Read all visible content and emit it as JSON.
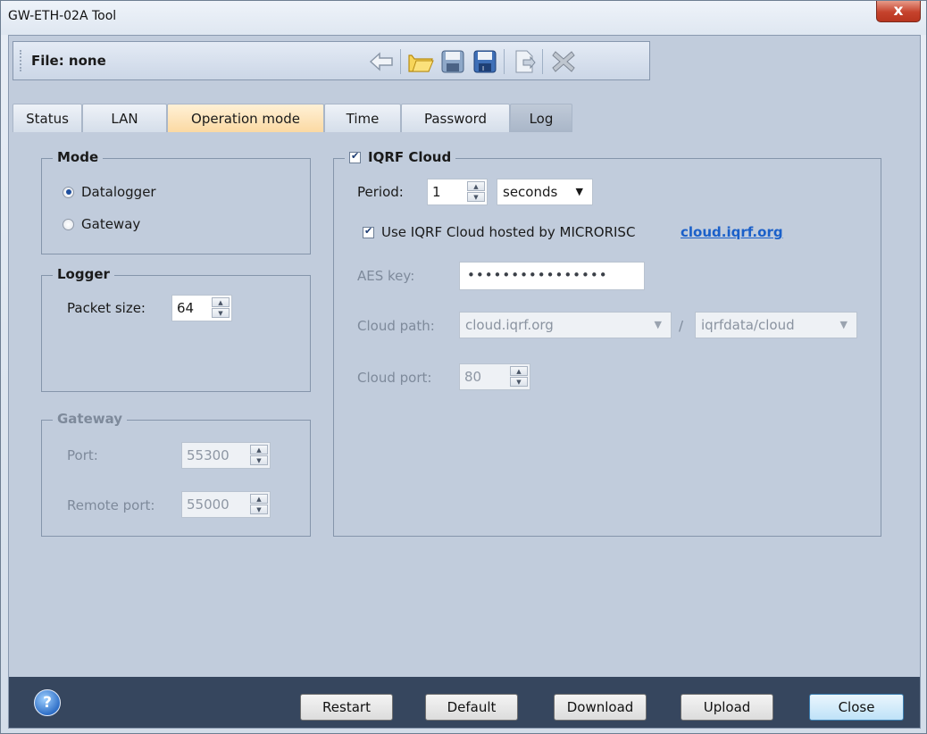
{
  "window": {
    "title": "GW-ETH-02A Tool",
    "close_glyph": "x"
  },
  "toolbar": {
    "file_label": "File: none",
    "icons": [
      "back-arrow-icon",
      "open-folder-icon",
      "save-icon",
      "save-as-icon",
      "export-icon",
      "delete-icon"
    ]
  },
  "tabs": [
    {
      "label": "Status"
    },
    {
      "label": "LAN"
    },
    {
      "label": "Operation mode"
    },
    {
      "label": "Time"
    },
    {
      "label": "Password"
    },
    {
      "label": "Log"
    }
  ],
  "mode": {
    "legend": "Mode",
    "options": [
      {
        "label": "Datalogger",
        "selected": true
      },
      {
        "label": "Gateway",
        "selected": false
      }
    ]
  },
  "logger": {
    "legend": "Logger",
    "packet_size_label": "Packet size:",
    "packet_size": "64"
  },
  "gateway": {
    "legend": "Gateway",
    "port_label": "Port:",
    "port": "55300",
    "remote_port_label": "Remote port:",
    "remote_port": "55000"
  },
  "cloud": {
    "legend": "IQRF Cloud",
    "enabled": true,
    "period_label": "Period:",
    "period": "1",
    "period_unit": "seconds",
    "use_hosted_label": "Use IQRF Cloud hosted by MICRORISC",
    "link": "cloud.iqrf.org",
    "aes_label": "AES key:",
    "aes_value": "••••••••••••••••",
    "path_label": "Cloud path:",
    "path_host": "cloud.iqrf.org",
    "path_separator": "/",
    "path_dir": "iqrfdata/cloud",
    "port_label": "Cloud port:",
    "port": "80"
  },
  "footer": {
    "help_glyph": "?",
    "buttons": [
      "Restart",
      "Default",
      "Download",
      "Upload",
      "Close"
    ]
  }
}
